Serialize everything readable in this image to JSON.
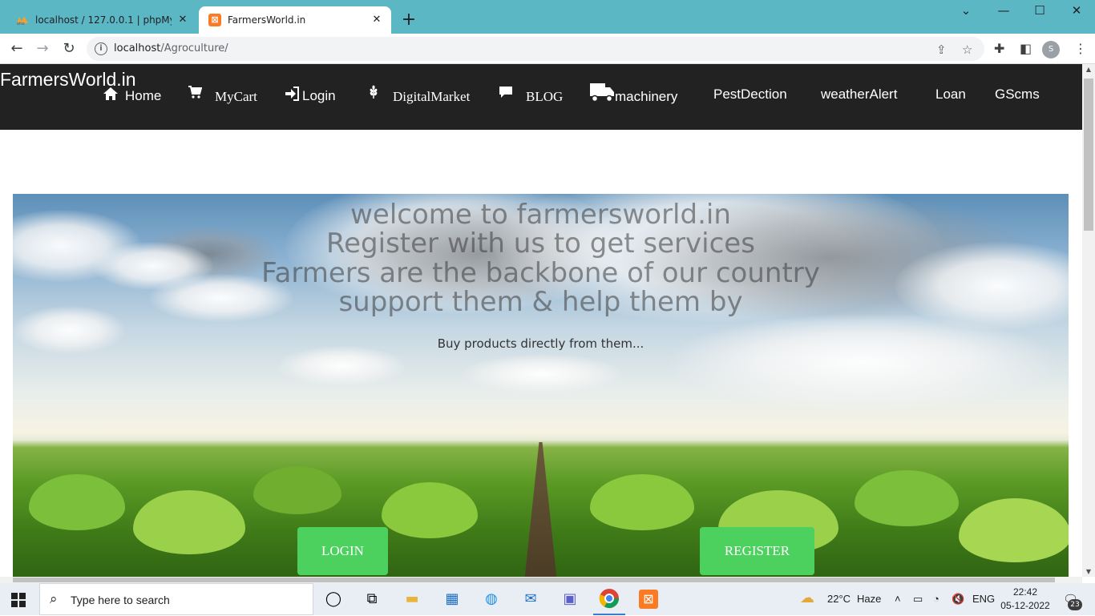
{
  "browser": {
    "tabs": [
      {
        "title": "localhost / 127.0.0.1 | phpMyAdmin",
        "favicon": "phpmyadmin-icon",
        "active": false
      },
      {
        "title": "FarmersWorld.in",
        "favicon": "xampp-icon",
        "active": true
      }
    ],
    "close_glyph": "✕",
    "new_tab_glyph": "+",
    "url_host": "localhost",
    "url_path": "/Agroculture/",
    "profile_initial": "S"
  },
  "site": {
    "brand": "FarmersWorld.in",
    "nav": [
      {
        "label": "Home",
        "icon": "home-icon"
      },
      {
        "label": "MyCart",
        "icon": "cart-icon"
      },
      {
        "label": "Login",
        "icon": "login-icon"
      },
      {
        "label": "DigitalMarket",
        "icon": "wheat-icon"
      },
      {
        "label": "BLOG",
        "icon": "comment-icon"
      },
      {
        "label": "machinery",
        "icon": "truck-icon"
      },
      {
        "label": "PestDection",
        "icon": ""
      },
      {
        "label": "weatherAlert",
        "icon": ""
      },
      {
        "label": "Loan",
        "icon": ""
      },
      {
        "label": "GScms",
        "icon": ""
      }
    ],
    "hero": {
      "lines": [
        "welcome to farmersworld.in",
        "Register with us to get services",
        "Farmers are the backbone of our country",
        "support them & help them by"
      ],
      "subtitle": "Buy products directly from them...",
      "login_button": "LOGIN",
      "register_button": "REGISTER"
    }
  },
  "taskbar": {
    "search_placeholder": "Type here to search",
    "weather_temp": "22°C",
    "weather_desc": "Haze",
    "language": "ENG",
    "time": "22:42",
    "date": "05-12-2022",
    "notifications": "23"
  },
  "colors": {
    "tab_strip": "#5cb7c4",
    "navbar": "#222222",
    "hero_button": "#4dd15e"
  }
}
